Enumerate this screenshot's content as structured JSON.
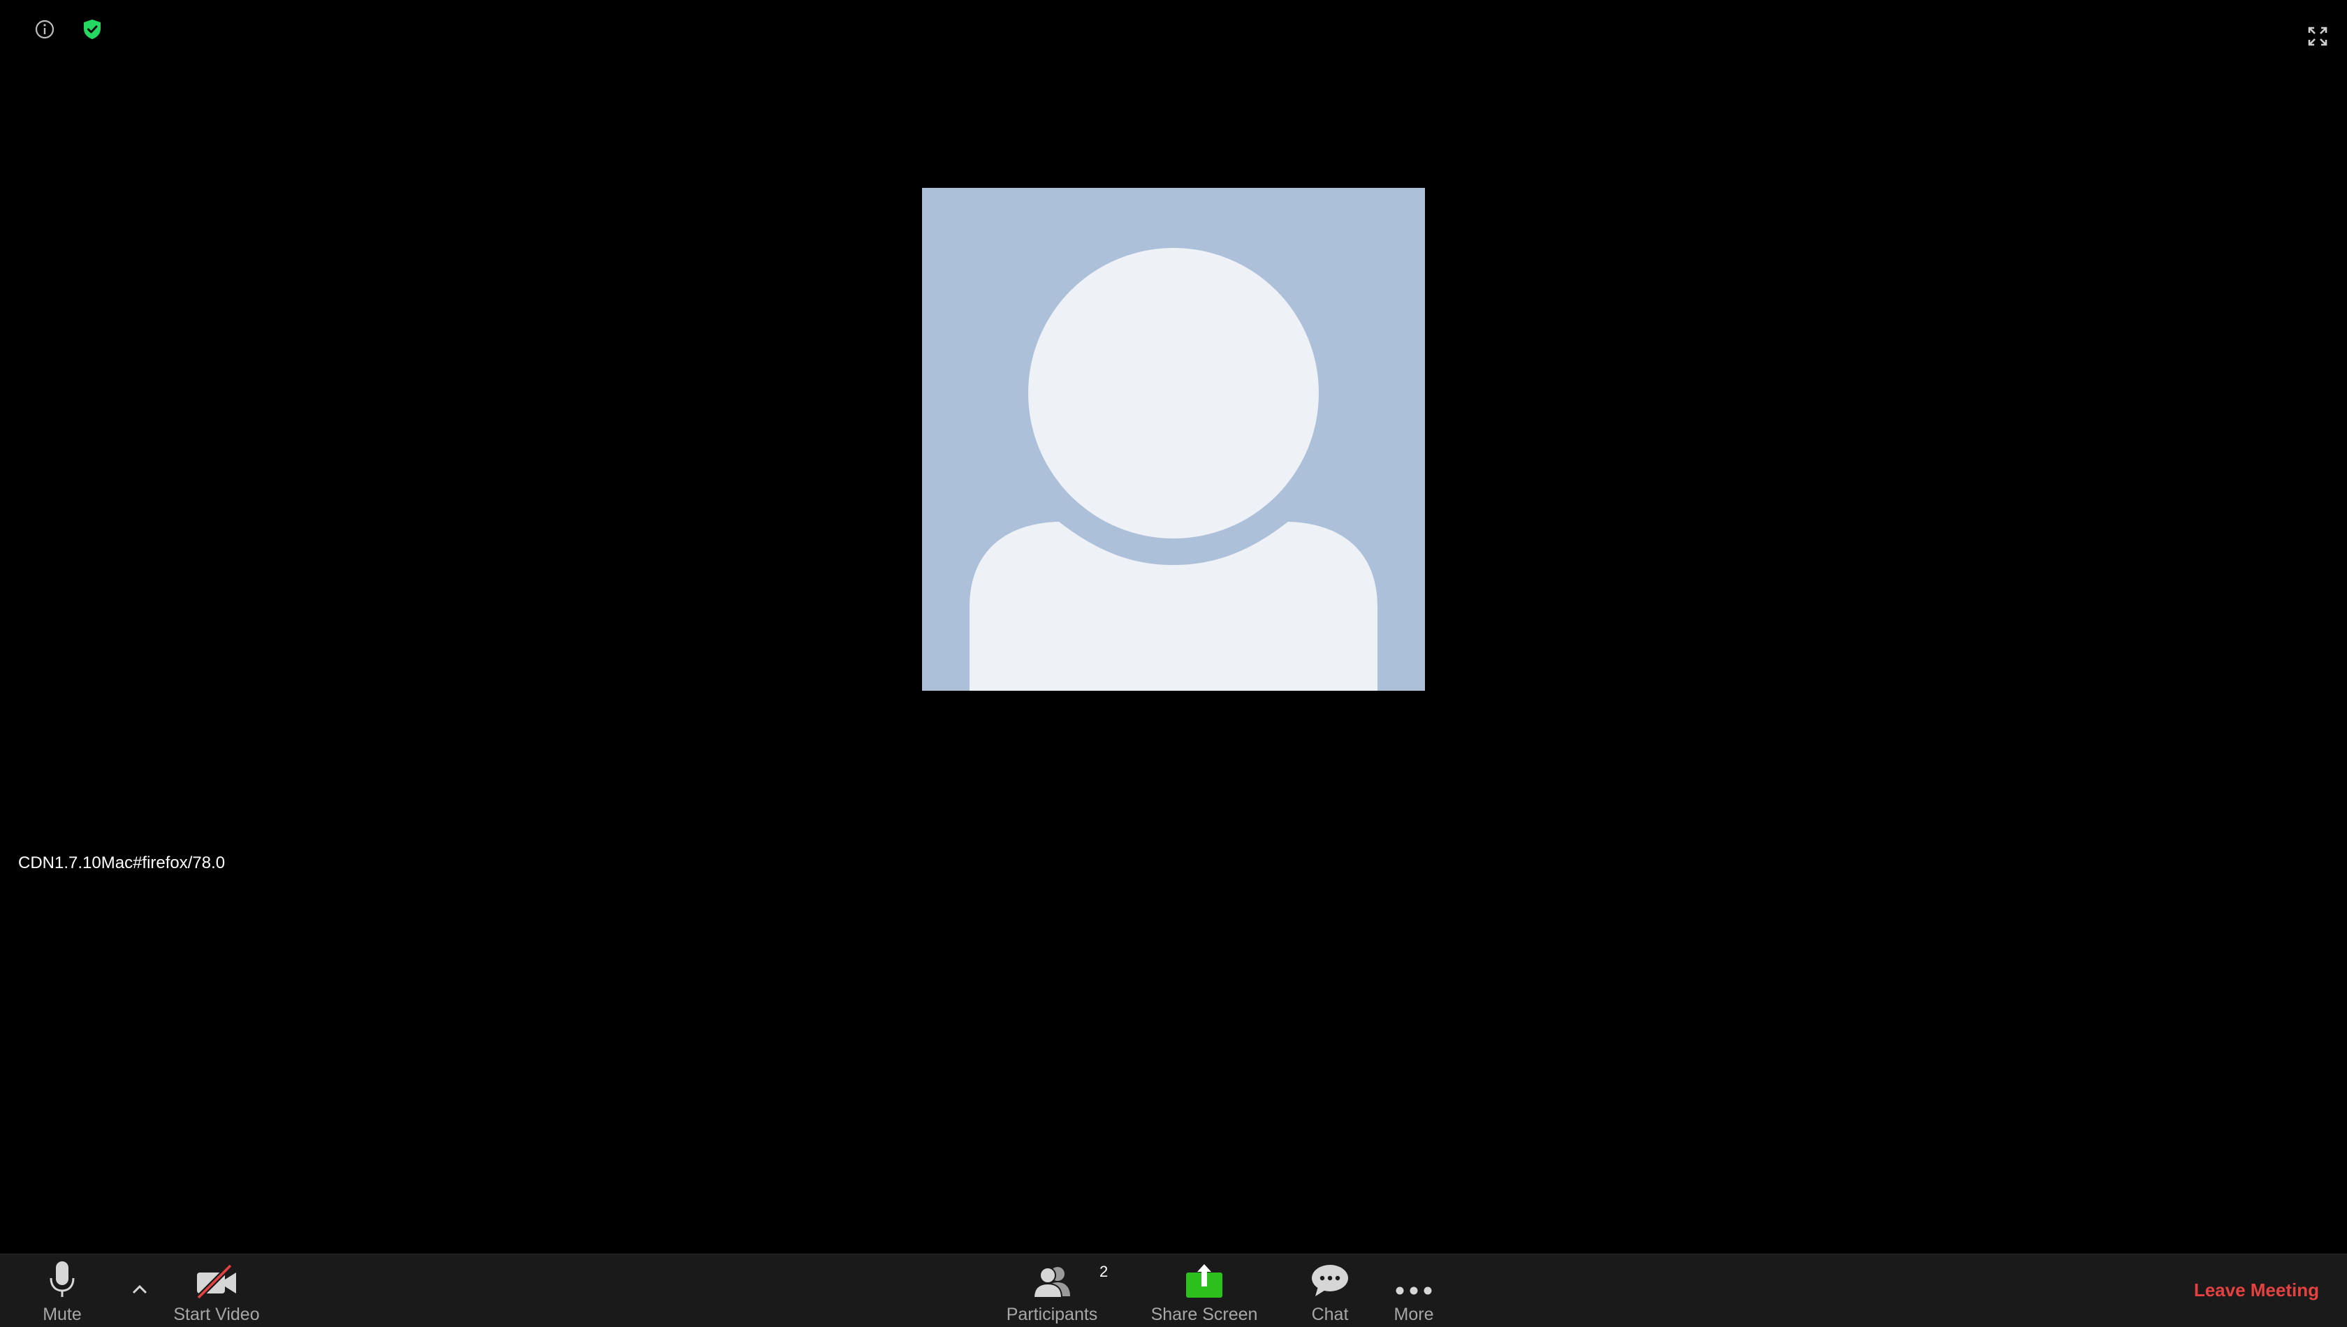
{
  "top_bar": {
    "info_icon": "info-circle-icon",
    "security_icon": "shield-check-icon",
    "fullscreen_icon": "fullscreen-expand-icon"
  },
  "video": {
    "avatar_icon": "default-user-silhouette",
    "tile_color": "#adc0da",
    "silhouette_color": "#eef1f6"
  },
  "version_label": "CDN1.7.10Mac#firefox/78.0",
  "toolbar": {
    "mute_label": "Mute",
    "start_video_label": "Start Video",
    "participants_label": "Participants",
    "participants_count": "2",
    "share_screen_label": "Share Screen",
    "chat_label": "Chat",
    "more_label": "More",
    "leave_label": "Leave Meeting"
  },
  "colors": {
    "background": "#000000",
    "toolbar": "#1a1a1a",
    "share_green": "#2dbf1c",
    "leave_red": "#e64141",
    "security_green": "#23d961",
    "video_off_red": "#e64141"
  }
}
